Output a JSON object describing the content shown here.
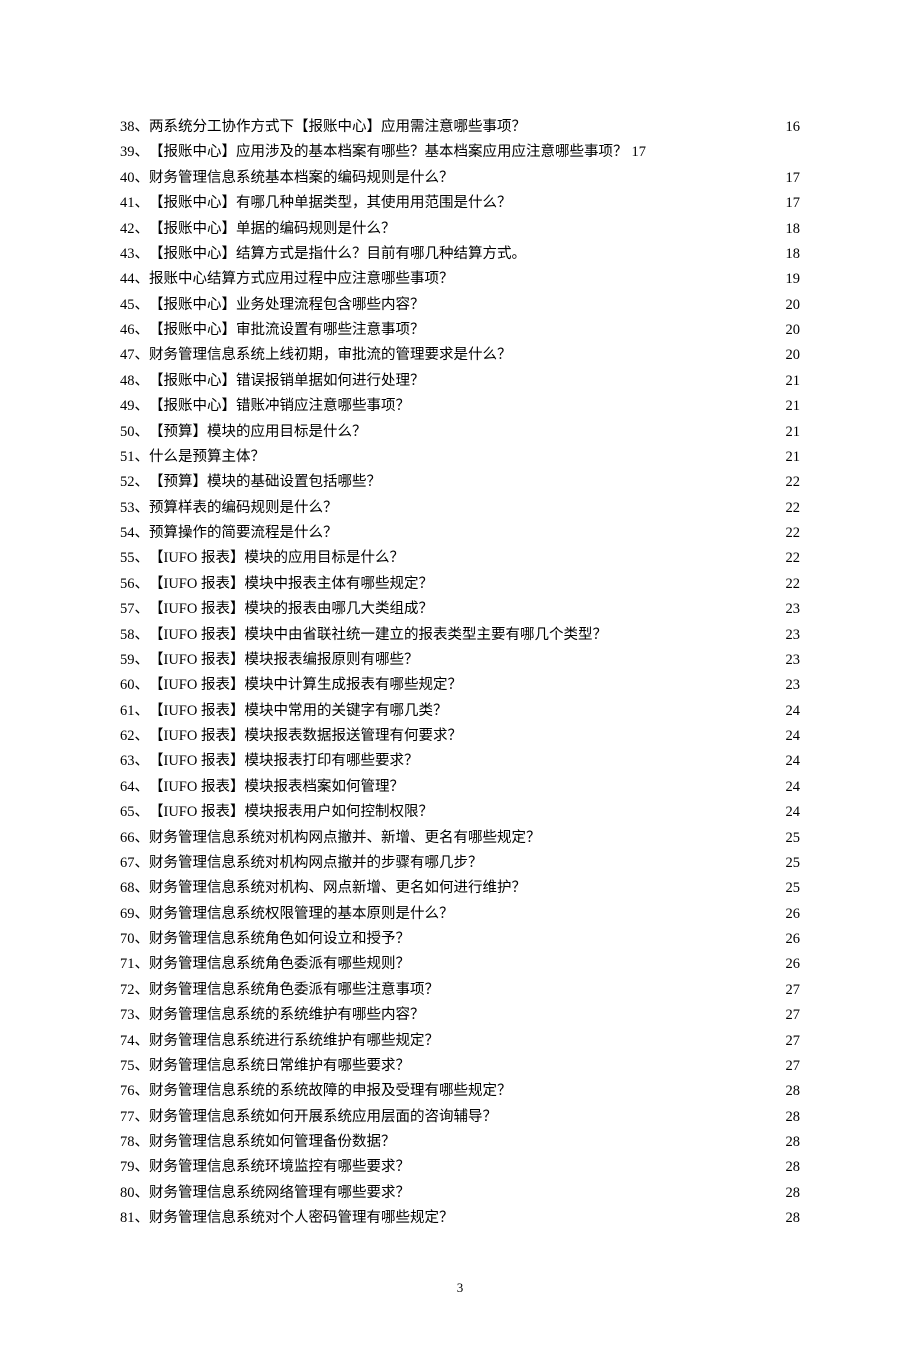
{
  "page_number": "3",
  "toc": [
    {
      "num": "38、",
      "title": "两系统分工协作方式下【报账中心】应用需注意哪些事项？",
      "page": "16",
      "dots": true
    },
    {
      "num": "39、",
      "title": "【报账中心】应用涉及的基本档案有哪些？基本档案应用应注意哪些事项？",
      "page": "17",
      "dots": false
    },
    {
      "num": "40、",
      "title": "财务管理信息系统基本档案的编码规则是什么？",
      "page": "17",
      "dots": true
    },
    {
      "num": "41、",
      "title": "【报账中心】有哪几种单据类型，其使用用范围是什么？",
      "page": "17",
      "dots": true
    },
    {
      "num": "42、",
      "title": "【报账中心】单据的编码规则是什么？",
      "page": "18",
      "dots": true
    },
    {
      "num": "43、",
      "title": "【报账中心】结算方式是指什么？目前有哪几种结算方式。",
      "page": "18",
      "dots": true
    },
    {
      "num": "44、",
      "title": "报账中心结算方式应用过程中应注意哪些事项？",
      "page": "19",
      "dots": true
    },
    {
      "num": "45、",
      "title": "【报账中心】业务处理流程包含哪些内容？",
      "page": "20",
      "dots": true
    },
    {
      "num": "46、",
      "title": "【报账中心】审批流设置有哪些注意事项？",
      "page": "20",
      "dots": true
    },
    {
      "num": "47、",
      "title": "财务管理信息系统上线初期，审批流的管理要求是什么？",
      "page": "20",
      "dots": true
    },
    {
      "num": "48、",
      "title": "【报账中心】错误报销单据如何进行处理？",
      "page": "21",
      "dots": true
    },
    {
      "num": "49、",
      "title": "【报账中心】错账冲销应注意哪些事项？",
      "page": "21",
      "dots": true
    },
    {
      "num": "50、",
      "title": "【预算】模块的应用目标是什么？",
      "page": "21",
      "dots": true
    },
    {
      "num": "51、",
      "title": "什么是预算主体？",
      "page": "21",
      "dots": true
    },
    {
      "num": "52、",
      "title": "【预算】模块的基础设置包括哪些？",
      "page": "22",
      "dots": true
    },
    {
      "num": "53、",
      "title": "预算样表的编码规则是什么？",
      "page": "22",
      "dots": true
    },
    {
      "num": "54、",
      "title": "预算操作的简要流程是什么？",
      "page": "22",
      "dots": true
    },
    {
      "num": "55、",
      "title": "【IUFO 报表】模块的应用目标是什么？",
      "page": "22",
      "dots": true
    },
    {
      "num": "56、",
      "title": "【IUFO 报表】模块中报表主体有哪些规定？",
      "page": "22",
      "dots": true
    },
    {
      "num": "57、",
      "title": "【IUFO 报表】模块的报表由哪几大类组成？",
      "page": "23",
      "dots": true
    },
    {
      "num": "58、",
      "title": "【IUFO 报表】模块中由省联社统一建立的报表类型主要有哪几个类型？",
      "page": "23",
      "dots": true
    },
    {
      "num": "59、",
      "title": "【IUFO 报表】模块报表编报原则有哪些？",
      "page": "23",
      "dots": true
    },
    {
      "num": "60、",
      "title": "【IUFO 报表】模块中计算生成报表有哪些规定？",
      "page": "23",
      "dots": true
    },
    {
      "num": "61、",
      "title": "【IUFO 报表】模块中常用的关键字有哪几类？",
      "page": "24",
      "dots": true
    },
    {
      "num": "62、",
      "title": "【IUFO 报表】模块报表数据报送管理有何要求？",
      "page": "24",
      "dots": true
    },
    {
      "num": "63、",
      "title": "【IUFO 报表】模块报表打印有哪些要求？",
      "page": "24",
      "dots": true
    },
    {
      "num": "64、",
      "title": "【IUFO 报表】模块报表档案如何管理？",
      "page": "24",
      "dots": true
    },
    {
      "num": "65、",
      "title": "【IUFO 报表】模块报表用户如何控制权限？",
      "page": "24",
      "dots": true
    },
    {
      "num": "66、",
      "title": "财务管理信息系统对机构网点撤并、新增、更名有哪些规定？",
      "page": "25",
      "dots": true
    },
    {
      "num": "67、",
      "title": "财务管理信息系统对机构网点撤并的步骤有哪几步？",
      "page": "25",
      "dots": true
    },
    {
      "num": "68、",
      "title": "财务管理信息系统对机构、网点新增、更名如何进行维护？",
      "page": "25",
      "dots": true
    },
    {
      "num": "69、",
      "title": "财务管理信息系统权限管理的基本原则是什么？",
      "page": "26",
      "dots": true
    },
    {
      "num": "70、",
      "title": "财务管理信息系统角色如何设立和授予？",
      "page": "26",
      "dots": true
    },
    {
      "num": "71、",
      "title": "财务管理信息系统角色委派有哪些规则？",
      "page": "26",
      "dots": true
    },
    {
      "num": "72、",
      "title": "财务管理信息系统角色委派有哪些注意事项？",
      "page": "27",
      "dots": true
    },
    {
      "num": "73、",
      "title": "财务管理信息系统的系统维护有哪些内容？",
      "page": "27",
      "dots": true
    },
    {
      "num": "74、",
      "title": "财务管理信息系统进行系统维护有哪些规定？",
      "page": "27",
      "dots": true
    },
    {
      "num": "75、",
      "title": "财务管理信息系统日常维护有哪些要求？",
      "page": "27",
      "dots": true
    },
    {
      "num": "76、",
      "title": "财务管理信息系统的系统故障的申报及受理有哪些规定？",
      "page": "28",
      "dots": true
    },
    {
      "num": "77、",
      "title": "财务管理信息系统如何开展系统应用层面的咨询辅导？",
      "page": "28",
      "dots": true
    },
    {
      "num": "78、",
      "title": "财务管理信息系统如何管理备份数据？",
      "page": "28",
      "dots": true
    },
    {
      "num": "79、",
      "title": "财务管理信息系统环境监控有哪些要求？",
      "page": "28",
      "dots": true
    },
    {
      "num": "80、",
      "title": "财务管理信息系统网络管理有哪些要求？",
      "page": "28",
      "dots": true
    },
    {
      "num": "81、",
      "title": "财务管理信息系统对个人密码管理有哪些规定？",
      "page": "28",
      "dots": true
    }
  ]
}
